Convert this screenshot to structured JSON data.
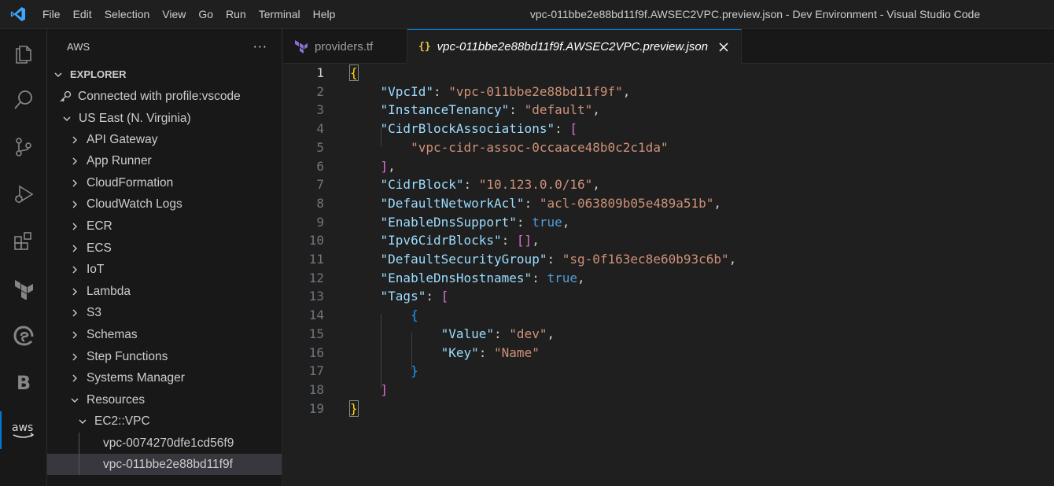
{
  "window": {
    "title": "vpc-011bbe2e88bd11f9f.AWSEC2VPC.preview.json - Dev Environment - Visual Studio Code"
  },
  "menu": [
    "File",
    "Edit",
    "Selection",
    "View",
    "Go",
    "Run",
    "Terminal",
    "Help"
  ],
  "activity_bar": [
    "explorer-icon",
    "search-icon",
    "source-control-icon",
    "run-debug-icon",
    "extensions-icon",
    "terraform-icon",
    "edge-icon",
    "b-icon",
    "aws-icon"
  ],
  "sidebar": {
    "title": "AWS",
    "more": "···",
    "section": "EXPLORER",
    "connection": "Connected with profile:vscode",
    "region": "US East (N. Virginia)",
    "services": [
      "API Gateway",
      "App Runner",
      "CloudFormation",
      "CloudWatch Logs",
      "ECR",
      "ECS",
      "IoT",
      "Lambda",
      "S3",
      "Schemas",
      "Step Functions",
      "Systems Manager"
    ],
    "resources": "Resources",
    "resource_type": "EC2::VPC",
    "vpcs": [
      "vpc-0074270dfe1cd56f9",
      "vpc-011bbe2e88bd11f9f"
    ]
  },
  "tabs": [
    {
      "label": "providers.tf",
      "active": false
    },
    {
      "label": "vpc-011bbe2e88bd11f9f.AWSEC2VPC.preview.json",
      "active": true
    }
  ],
  "editor": {
    "current_line": 1,
    "lines": [
      [
        [
          "br1",
          "{"
        ]
      ],
      [
        [
          "p",
          "    "
        ],
        [
          "k",
          "\"VpcId\""
        ],
        [
          "p",
          ": "
        ],
        [
          "s",
          "\"vpc-011bbe2e88bd11f9f\""
        ],
        [
          "p",
          ","
        ]
      ],
      [
        [
          "p",
          "    "
        ],
        [
          "k",
          "\"InstanceTenancy\""
        ],
        [
          "p",
          ": "
        ],
        [
          "s",
          "\"default\""
        ],
        [
          "p",
          ","
        ]
      ],
      [
        [
          "p",
          "    "
        ],
        [
          "k",
          "\"CidrBlockAssociations\""
        ],
        [
          "p",
          ": "
        ],
        [
          "br2",
          "["
        ]
      ],
      [
        [
          "p",
          "        "
        ],
        [
          "s",
          "\"vpc-cidr-assoc-0ccaace48b0c2c1da\""
        ]
      ],
      [
        [
          "p",
          "    "
        ],
        [
          "br2",
          "]"
        ],
        [
          "p",
          ","
        ]
      ],
      [
        [
          "p",
          "    "
        ],
        [
          "k",
          "\"CidrBlock\""
        ],
        [
          "p",
          ": "
        ],
        [
          "s",
          "\"10.123.0.0/16\""
        ],
        [
          "p",
          ","
        ]
      ],
      [
        [
          "p",
          "    "
        ],
        [
          "k",
          "\"DefaultNetworkAcl\""
        ],
        [
          "p",
          ": "
        ],
        [
          "s",
          "\"acl-063809b05e489a51b\""
        ],
        [
          "p",
          ","
        ]
      ],
      [
        [
          "p",
          "    "
        ],
        [
          "k",
          "\"EnableDnsSupport\""
        ],
        [
          "p",
          ": "
        ],
        [
          "b",
          "true"
        ],
        [
          "p",
          ","
        ]
      ],
      [
        [
          "p",
          "    "
        ],
        [
          "k",
          "\"Ipv6CidrBlocks\""
        ],
        [
          "p",
          ": "
        ],
        [
          "br2",
          "[]"
        ],
        [
          "p",
          ","
        ]
      ],
      [
        [
          "p",
          "    "
        ],
        [
          "k",
          "\"DefaultSecurityGroup\""
        ],
        [
          "p",
          ": "
        ],
        [
          "s",
          "\"sg-0f163ec8e60b93c6b\""
        ],
        [
          "p",
          ","
        ]
      ],
      [
        [
          "p",
          "    "
        ],
        [
          "k",
          "\"EnableDnsHostnames\""
        ],
        [
          "p",
          ": "
        ],
        [
          "b",
          "true"
        ],
        [
          "p",
          ","
        ]
      ],
      [
        [
          "p",
          "    "
        ],
        [
          "k",
          "\"Tags\""
        ],
        [
          "p",
          ": "
        ],
        [
          "br2",
          "["
        ]
      ],
      [
        [
          "p",
          "        "
        ],
        [
          "br3",
          "{"
        ]
      ],
      [
        [
          "p",
          "            "
        ],
        [
          "k",
          "\"Value\""
        ],
        [
          "p",
          ": "
        ],
        [
          "s",
          "\"dev\""
        ],
        [
          "p",
          ","
        ]
      ],
      [
        [
          "p",
          "            "
        ],
        [
          "k",
          "\"Key\""
        ],
        [
          "p",
          ": "
        ],
        [
          "s",
          "\"Name\""
        ]
      ],
      [
        [
          "p",
          "        "
        ],
        [
          "br3",
          "}"
        ]
      ],
      [
        [
          "p",
          "    "
        ],
        [
          "br2",
          "]"
        ]
      ],
      [
        [
          "br1",
          "}"
        ]
      ]
    ]
  }
}
